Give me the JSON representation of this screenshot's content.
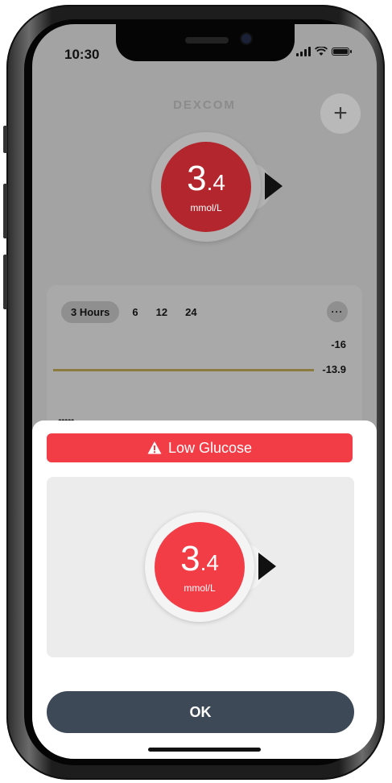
{
  "status_bar": {
    "time": "10:30",
    "signal_icon": "signal-icon",
    "wifi_icon": "wifi-icon",
    "battery_icon": "battery-icon"
  },
  "header": {
    "brand": "DEXCOM",
    "add_label": "+"
  },
  "background_gauge": {
    "value_int": "3",
    "value_dec": ".4",
    "unit": "mmol/L",
    "color": "#b3262d",
    "trend_icon": "trend-arrow-right-icon"
  },
  "graph_card": {
    "tabs": [
      {
        "label": "3 Hours",
        "active": true
      },
      {
        "label": "6",
        "active": false
      },
      {
        "label": "12",
        "active": false
      },
      {
        "label": "24",
        "active": false
      }
    ],
    "more_label": "···",
    "y_ticks": [
      "-16",
      "-13.9"
    ],
    "target_line_color": "#8c7b3e"
  },
  "alert": {
    "title": "Low Glucose",
    "banner_color": "#f23d47",
    "warning_icon": "warning-triangle-icon",
    "gauge": {
      "value_int": "3",
      "value_dec": ".4",
      "unit": "mmol/L",
      "color": "#f23d47",
      "trend_icon": "trend-arrow-right-icon"
    },
    "ok_label": "OK",
    "ok_color": "#3d4957"
  }
}
